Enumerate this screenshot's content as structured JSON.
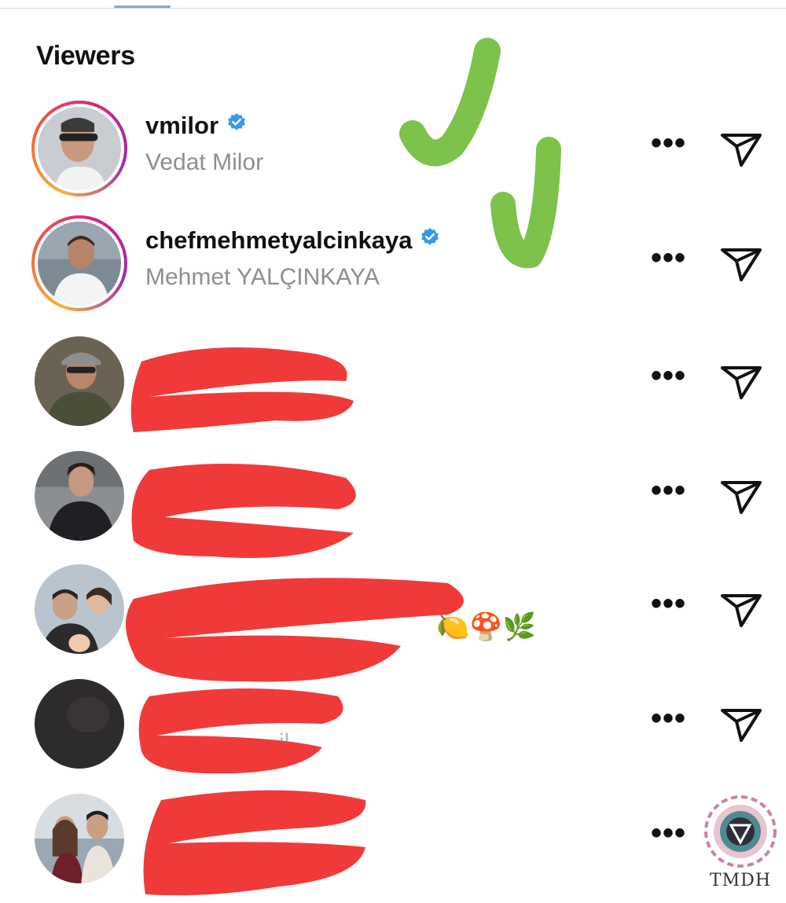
{
  "header": {
    "title": "Viewers"
  },
  "viewers": [
    {
      "username": "vmilor",
      "full_name": "Vedat Milor",
      "verified": true,
      "more_label": "•••",
      "send_icon": "send-icon"
    },
    {
      "username": "chefmehmetyalcinkaya",
      "full_name": "Mehmet YALÇINKAYA",
      "verified": true,
      "more_label": "•••",
      "send_icon": "send-icon"
    },
    {
      "username": "",
      "full_name": "",
      "redacted": true,
      "more_label": "•••",
      "send_icon": "send-icon"
    },
    {
      "username": "",
      "full_name": "",
      "redacted": true,
      "more_label": "•••",
      "send_icon": "send-icon"
    },
    {
      "username": "",
      "full_name": "",
      "redacted": true,
      "emojis": "🍋🍄🌿",
      "more_label": "•••",
      "send_icon": "send-icon"
    },
    {
      "username": "",
      "full_name": "",
      "redacted": true,
      "more_label": "•••",
      "send_icon": "send-icon"
    },
    {
      "username": "",
      "full_name": "",
      "redacted": true,
      "more_label": "•••"
    }
  ],
  "watermark": {
    "text": "TMDH"
  },
  "colors": {
    "verified": "#3897f0",
    "redaction": "#f03a3a",
    "checkmark": "#7dc24b",
    "secondary_text": "#8e8e8e"
  }
}
